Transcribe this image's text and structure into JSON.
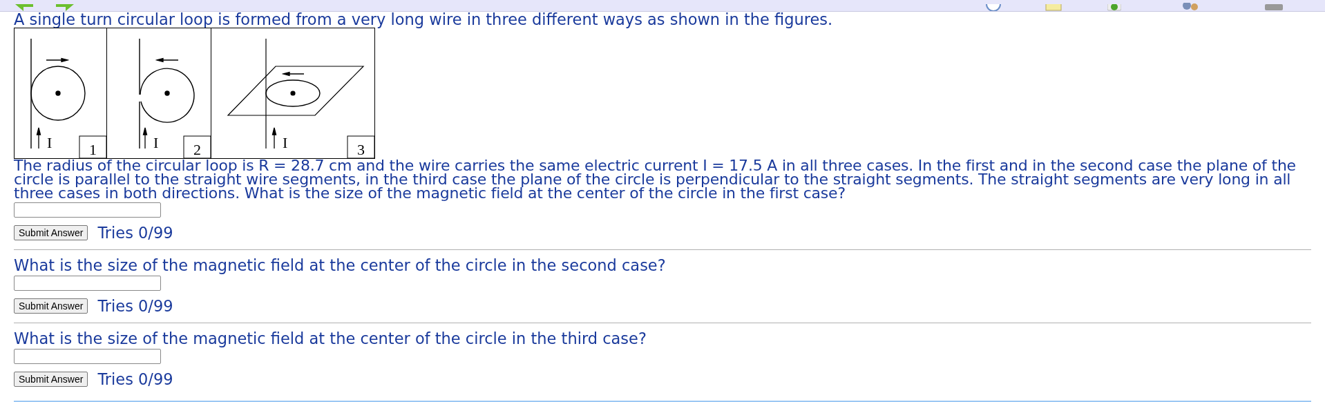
{
  "intro": "A single turn circular loop is formed from a very long wire in three different ways as shown in the figures.",
  "figure": {
    "panels": [
      {
        "kind": "tangent",
        "number": "1",
        "current_label": "I"
      },
      {
        "kind": "wrapped",
        "number": "2",
        "current_label": "I"
      },
      {
        "kind": "perpendicular",
        "number": "3",
        "current_label": "I"
      }
    ]
  },
  "problem": "The radius of the circular loop is R = 28.7 cm and the wire carries the same electric current I = 17.5 A in all three cases. In the first and in the second case the plane of the circle is parallel to the straight wire segments, in the third case the plane of the circle is perpendicular to the straight segments. The straight segments are very long in all three cases in both directions. What is the size of the magnetic field at the center of the circle in the first case?",
  "questions": [
    {
      "button": "Submit Answer",
      "tries": "Tries 0/99"
    },
    {
      "text": "What is the size of the magnetic field at the center of the circle in the second case?",
      "button": "Submit Answer",
      "tries": "Tries 0/99"
    },
    {
      "text": "What is the size of the magnetic field at the center of the circle in the third case?",
      "button": "Submit Answer",
      "tries": "Tries 0/99"
    }
  ]
}
